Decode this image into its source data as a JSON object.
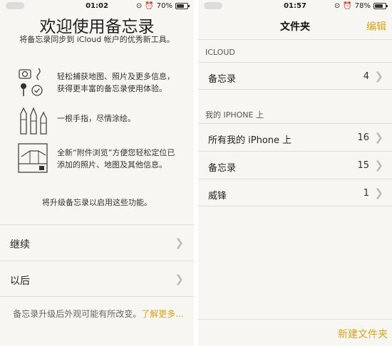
{
  "left": {
    "status": {
      "time": "01:02",
      "battery": "70%",
      "battery_level": 0.7
    },
    "title": "欢迎使用备忘录",
    "subtitle": "将备忘录同步到 iCloud 帐户的优秀新工具。",
    "features": [
      {
        "line1": "轻松捕获地图、照片及更多信息，",
        "line2": "获得更丰富的备忘录使用体验。",
        "icon": "camera-map-check-icon"
      },
      {
        "line1": "一根手指，尽情涂绘。",
        "line2": "",
        "icon": "pens-icon"
      },
      {
        "line1": "全新“附件浏览”方便您轻松定位已",
        "line2": "添加的照片、地图及其他信息。",
        "icon": "attachment-browser-icon"
      }
    ],
    "upgrade_text": "将升级备忘录以启用这些功能。",
    "continue_label": "继续",
    "later_label": "以后",
    "footer_text": "备忘录升级后外观可能有所改变。",
    "footer_link": "了解更多..."
  },
  "right": {
    "status": {
      "time": "01:57",
      "battery": "78%",
      "battery_level": 0.78
    },
    "nav_title": "文件夹",
    "edit_label": "编辑",
    "section_icloud": "ICLOUD",
    "icloud_folders": [
      {
        "name": "备忘录",
        "count": "4"
      }
    ],
    "section_iphone": "我的 IPHONE 上",
    "iphone_folders": [
      {
        "name": "所有我的 iPhone 上",
        "count": "16"
      },
      {
        "name": "备忘录",
        "count": "15"
      },
      {
        "name": "威锋",
        "count": "1"
      }
    ],
    "new_folder_label": "新建文件夹"
  },
  "colors": {
    "accent": "#d8a31e",
    "background": "#f7f6f2"
  }
}
